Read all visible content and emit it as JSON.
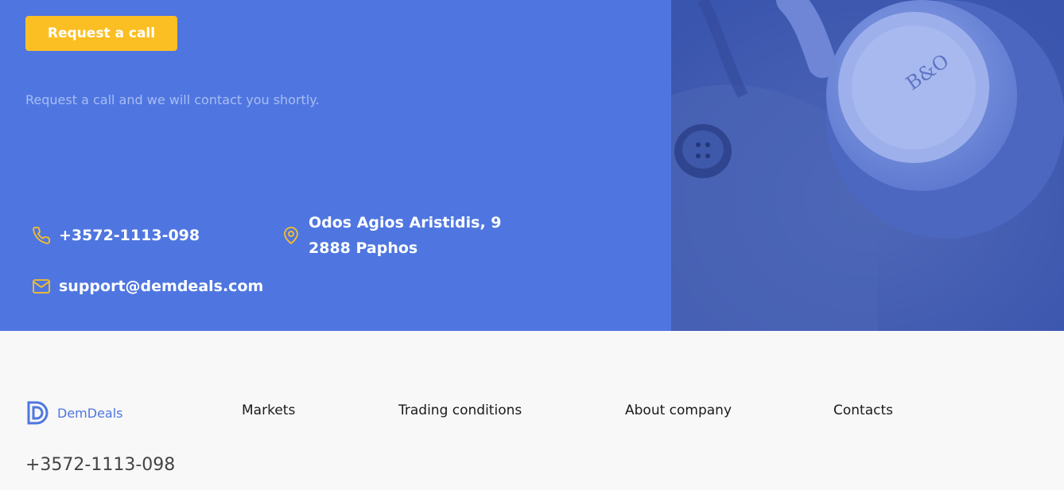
{
  "hero": {
    "cta_label": "Request a call",
    "subtitle": "Request a call and we will contact you shortly.",
    "phone": "+3572-1113-098",
    "address": "Odos Agios Aristidis, 9 2888 Paphos",
    "email": "support@demdeals.com",
    "accent_color": "#fbbf24",
    "panel_color": "#4f76e0",
    "image_caption": "B&O"
  },
  "footer": {
    "brand": "DemDeals",
    "nav": [
      "Markets",
      "Trading conditions",
      "About company",
      "Contacts"
    ],
    "phone": "+3572-1113-098"
  }
}
